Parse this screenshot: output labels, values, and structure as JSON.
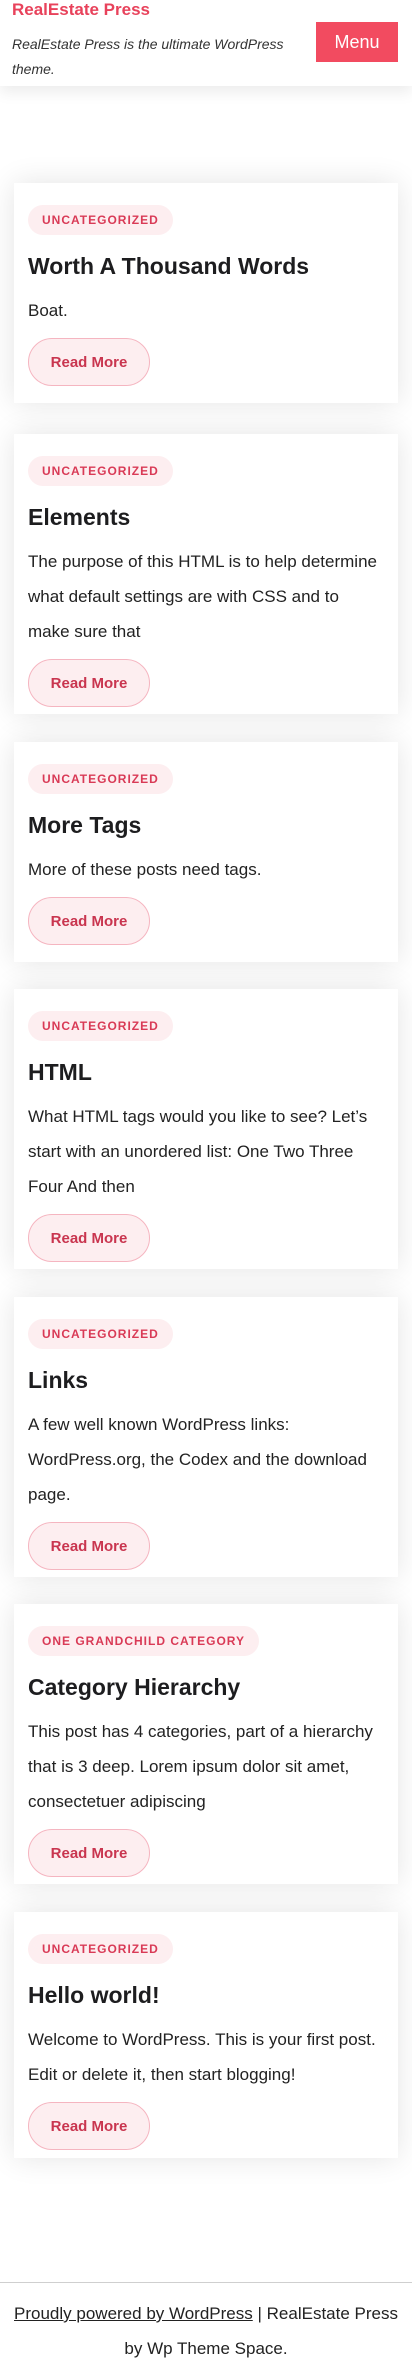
{
  "header": {
    "site_title": "RealEstate Press",
    "description": "RealEstate Press is the ultimate WordPress theme.",
    "menu_label": "Menu"
  },
  "posts": [
    {
      "category": "UNCATEGORIZED",
      "title": "Worth A Thousand Words",
      "excerpt": "Boat.",
      "read_more": "Read More"
    },
    {
      "category": "UNCATEGORIZED",
      "title": "Elements",
      "excerpt": "The purpose of this HTML is to help determine what default settings are with CSS and to make sure that",
      "read_more": "Read More"
    },
    {
      "category": "UNCATEGORIZED",
      "title": "More Tags",
      "excerpt": "More of these posts need tags.",
      "read_more": "Read More"
    },
    {
      "category": "UNCATEGORIZED",
      "title": "HTML",
      "excerpt": "What HTML tags would you like to see? Let’s start with an unordered list: One Two Three Four And then",
      "read_more": "Read More"
    },
    {
      "category": "UNCATEGORIZED",
      "title": "Links",
      "excerpt": "A few well known WordPress links: WordPress.org, the Codex and the download page.",
      "read_more": "Read More"
    },
    {
      "category": "ONE GRANDCHILD CATEGORY",
      "title": "Category Hierarchy",
      "excerpt": "This post has 4 categories, part of a hierarchy that is 3 deep. Lorem ipsum dolor sit amet, consectetuer adipiscing",
      "read_more": "Read More"
    },
    {
      "category": "UNCATEGORIZED",
      "title": "Hello world!",
      "excerpt": "Welcome to WordPress. This is your first post. Edit or delete it, then start blogging!",
      "read_more": "Read More"
    }
  ],
  "footer": {
    "powered_link": "Proudly powered by WordPress",
    "separator": " | ",
    "credit": "RealEstate Press by Wp Theme Space."
  },
  "colors": {
    "accent": "#f24b60",
    "title": "#e8425b",
    "badge_bg": "#fdeef0",
    "badge_text": "#d93a56"
  }
}
